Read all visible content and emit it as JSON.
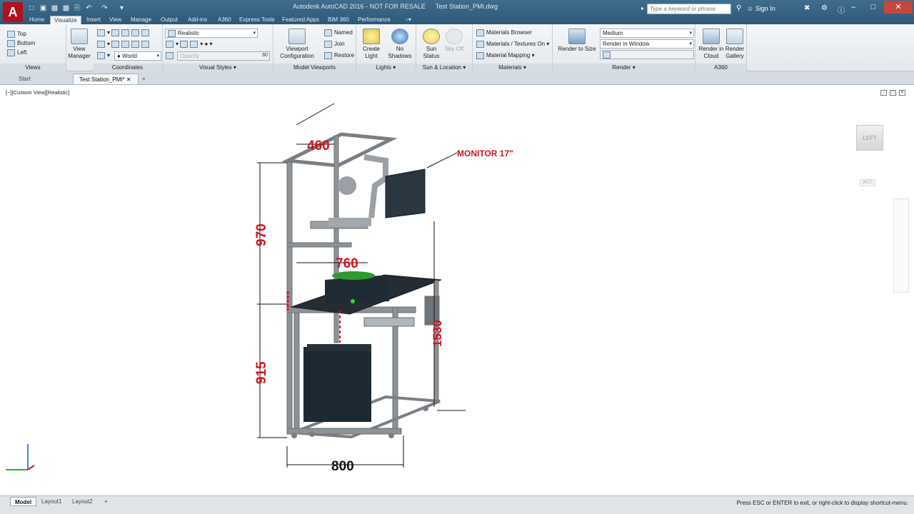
{
  "app": {
    "logo_letter": "A",
    "window_title": "Autodesk AutoCAD 2016 - NOT FOR RESALE",
    "document_title": "Test Station_PMI.dwg",
    "search_placeholder": "Type a keyword or phrase",
    "sign_in": "Sign In"
  },
  "ribbon_tabs": [
    "Home",
    "Visualize",
    "Insert",
    "View",
    "Manage",
    "Output",
    "Add-ins",
    "A360",
    "Express Tools",
    "Featured Apps",
    "BIM 360",
    "Performance"
  ],
  "active_tab": "Visualize",
  "ribbon": {
    "views": {
      "title": "Views",
      "items": [
        "Top",
        "Bottom",
        "Left"
      ]
    },
    "view_manager": "View\nManager",
    "coordinates": {
      "title": "Coordinates",
      "world": "World"
    },
    "visual_styles": {
      "title": "Visual Styles",
      "current": "Realistic",
      "opacity_label": "Opacity",
      "opacity_value": "60"
    },
    "model_viewports": {
      "title": "Model Viewports",
      "config": "Viewport\nConfiguration",
      "named": "Named",
      "join": "Join",
      "restore": "Restore"
    },
    "lights": {
      "title": "Lights",
      "create": "Create\nLight",
      "shadows": "No\nShadows"
    },
    "sun_location": {
      "title": "Sun & Location",
      "sun_status": "Sun\nStatus",
      "sky_off": "Sky Off"
    },
    "materials": {
      "title": "Materials",
      "browser": "Materials Browser",
      "textures": "Materials / Textures On",
      "mapping": "Material Mapping"
    },
    "render": {
      "title": "Render",
      "render_to_size": "Render to Size",
      "quality": "Medium",
      "target": "Render in Window"
    },
    "a360": {
      "title": "A360",
      "cloud": "Render in\nCloud",
      "gallery": "Render\nGallery"
    }
  },
  "doc_tabs": [
    "Start",
    "Test Station_PMI*"
  ],
  "active_doc_tab": "Test Station_PMI*",
  "viewport": {
    "label": "[−][Custom View][Realistic]",
    "viewcube_face": "LEFT",
    "wcs": "WCS",
    "annotations": {
      "monitor": "MONITOR 17\"",
      "dim_460": "460",
      "dim_970": "970",
      "dim_760": "760",
      "dim_1530": "1530",
      "dim_915": "915",
      "dim_800": "800"
    }
  },
  "layout_tabs": [
    "Model",
    "Layout1",
    "Layout2"
  ],
  "active_layout": "Model",
  "command_prompt": "Press ESC or ENTER to exit, or right-click to display shortcut-menu.",
  "colors": {
    "titlebar": "#2f5878",
    "app_button": "#b3111c",
    "dimension_red": "#d0141c",
    "frame_grey": "#7b7f83",
    "dark_panel": "#243038"
  }
}
